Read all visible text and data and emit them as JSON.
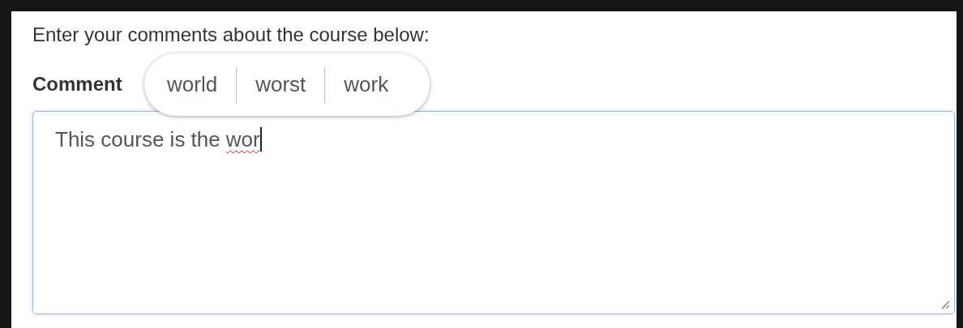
{
  "instruction": "Enter your comments about the course below:",
  "label": "Comment",
  "field": {
    "value": "This course is the",
    "misspelled": "wor"
  },
  "suggestions": [
    {
      "label": "world"
    },
    {
      "label": "worst"
    },
    {
      "label": "work"
    }
  ]
}
